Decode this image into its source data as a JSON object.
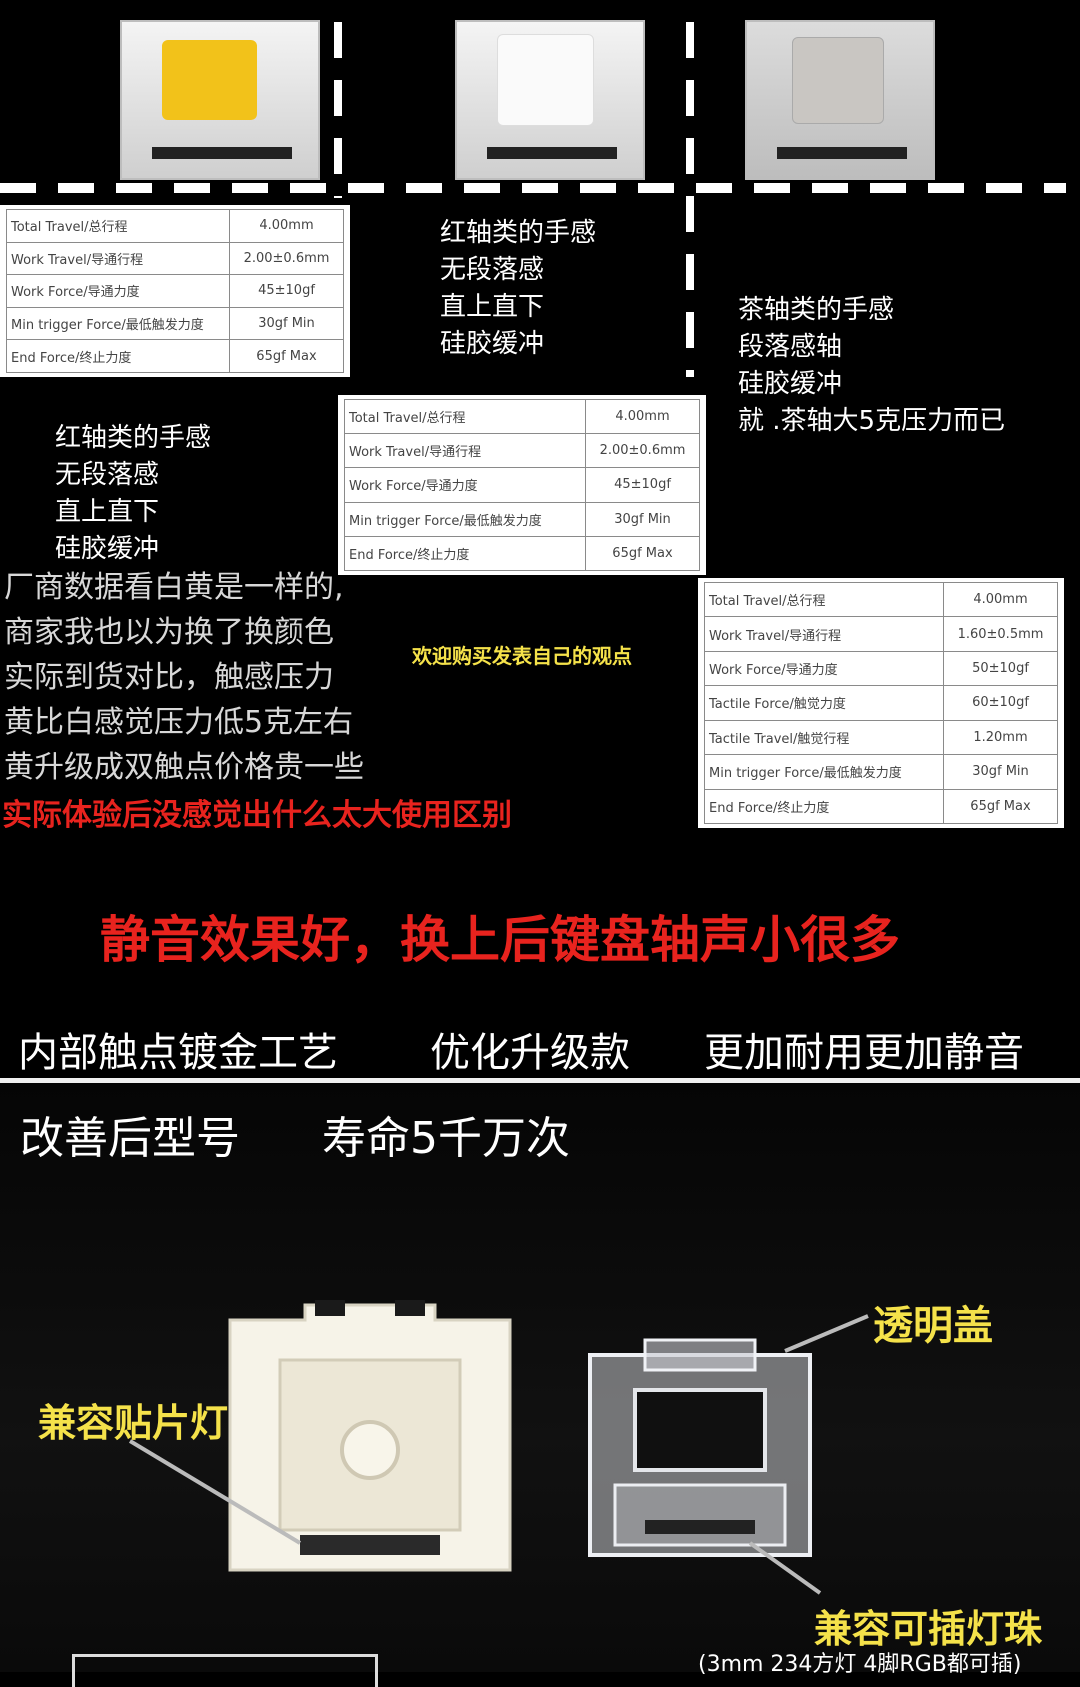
{
  "spec_tables": [
    {
      "rows": [
        {
          "label": "Total Travel/总行程",
          "value": "4.00mm"
        },
        {
          "label": "Work Travel/导通行程",
          "value": "2.00±0.6mm"
        },
        {
          "label": "Work Force/导通力度",
          "value": "45±10gf"
        },
        {
          "label": "Min trigger Force/最低触发力度",
          "value": "30gf Min"
        },
        {
          "label": "End Force/终止力度",
          "value": "65gf Max"
        }
      ]
    },
    {
      "rows": [
        {
          "label": "Total Travel/总行程",
          "value": "4.00mm"
        },
        {
          "label": "Work Travel/导通行程",
          "value": "2.00±0.6mm"
        },
        {
          "label": "Work Force/导通力度",
          "value": "45±10gf"
        },
        {
          "label": "Min trigger Force/最低触发力度",
          "value": "30gf Min"
        },
        {
          "label": "End Force/终止力度",
          "value": "65gf Max"
        }
      ]
    },
    {
      "rows": [
        {
          "label": "Total Travel/总行程",
          "value": "4.00mm"
        },
        {
          "label": "Work Travel/导通行程",
          "value": "1.60±0.5mm"
        },
        {
          "label": "Work Force/导通力度",
          "value": "50±10gf"
        },
        {
          "label": "Tactile Force/触觉力度",
          "value": "60±10gf"
        },
        {
          "label": "Tactile Travel/触觉行程",
          "value": "1.20mm"
        },
        {
          "label": "Min trigger Force/最低触发力度",
          "value": "30gf Min"
        },
        {
          "label": "End Force/终止力度",
          "value": "65gf Max"
        }
      ]
    }
  ],
  "red_notes_top": [
    "红轴类的手感",
    "无段落感",
    "直上直下",
    "硅胶缓冲"
  ],
  "red_notes_left": [
    "红轴类的手感",
    "无段落感",
    "直上直下",
    "硅胶缓冲"
  ],
  "brown_notes": [
    "茶轴类的手感",
    "段落感轴",
    "硅胶缓冲",
    "就  .茶轴大5克压力而已"
  ],
  "comparison_lines": [
    "厂商数据看白黄是一样的,",
    "商家我也以为换了换颜色",
    "实际到货对比，触感压力",
    "黄比白感觉压力低5克左右",
    "黄升级成双触点价格贵一些"
  ],
  "comparison_red": "实际体验后没感觉出什么太大使用区别",
  "welcome_note": "欢迎购买发表自己的观点",
  "silent_banner": "静音效果好，换上后键盘轴声小很多",
  "features": [
    "内部触点镀金工艺",
    "优化升级款",
    "更加耐用更加静音"
  ],
  "improved_title": "改善后型号",
  "lifespan": "寿命5千万次",
  "callouts": {
    "clear_cover": "透明盖",
    "smd_led": "兼容贴片灯",
    "plugin_led": "兼容可插灯珠",
    "led_note": "(3mm 234方灯 4脚RGB都可插)"
  },
  "colors": {
    "yellow_stem": "#f2c21a",
    "red_text": "#e8231e",
    "yellow_text": "#f5e24a"
  }
}
